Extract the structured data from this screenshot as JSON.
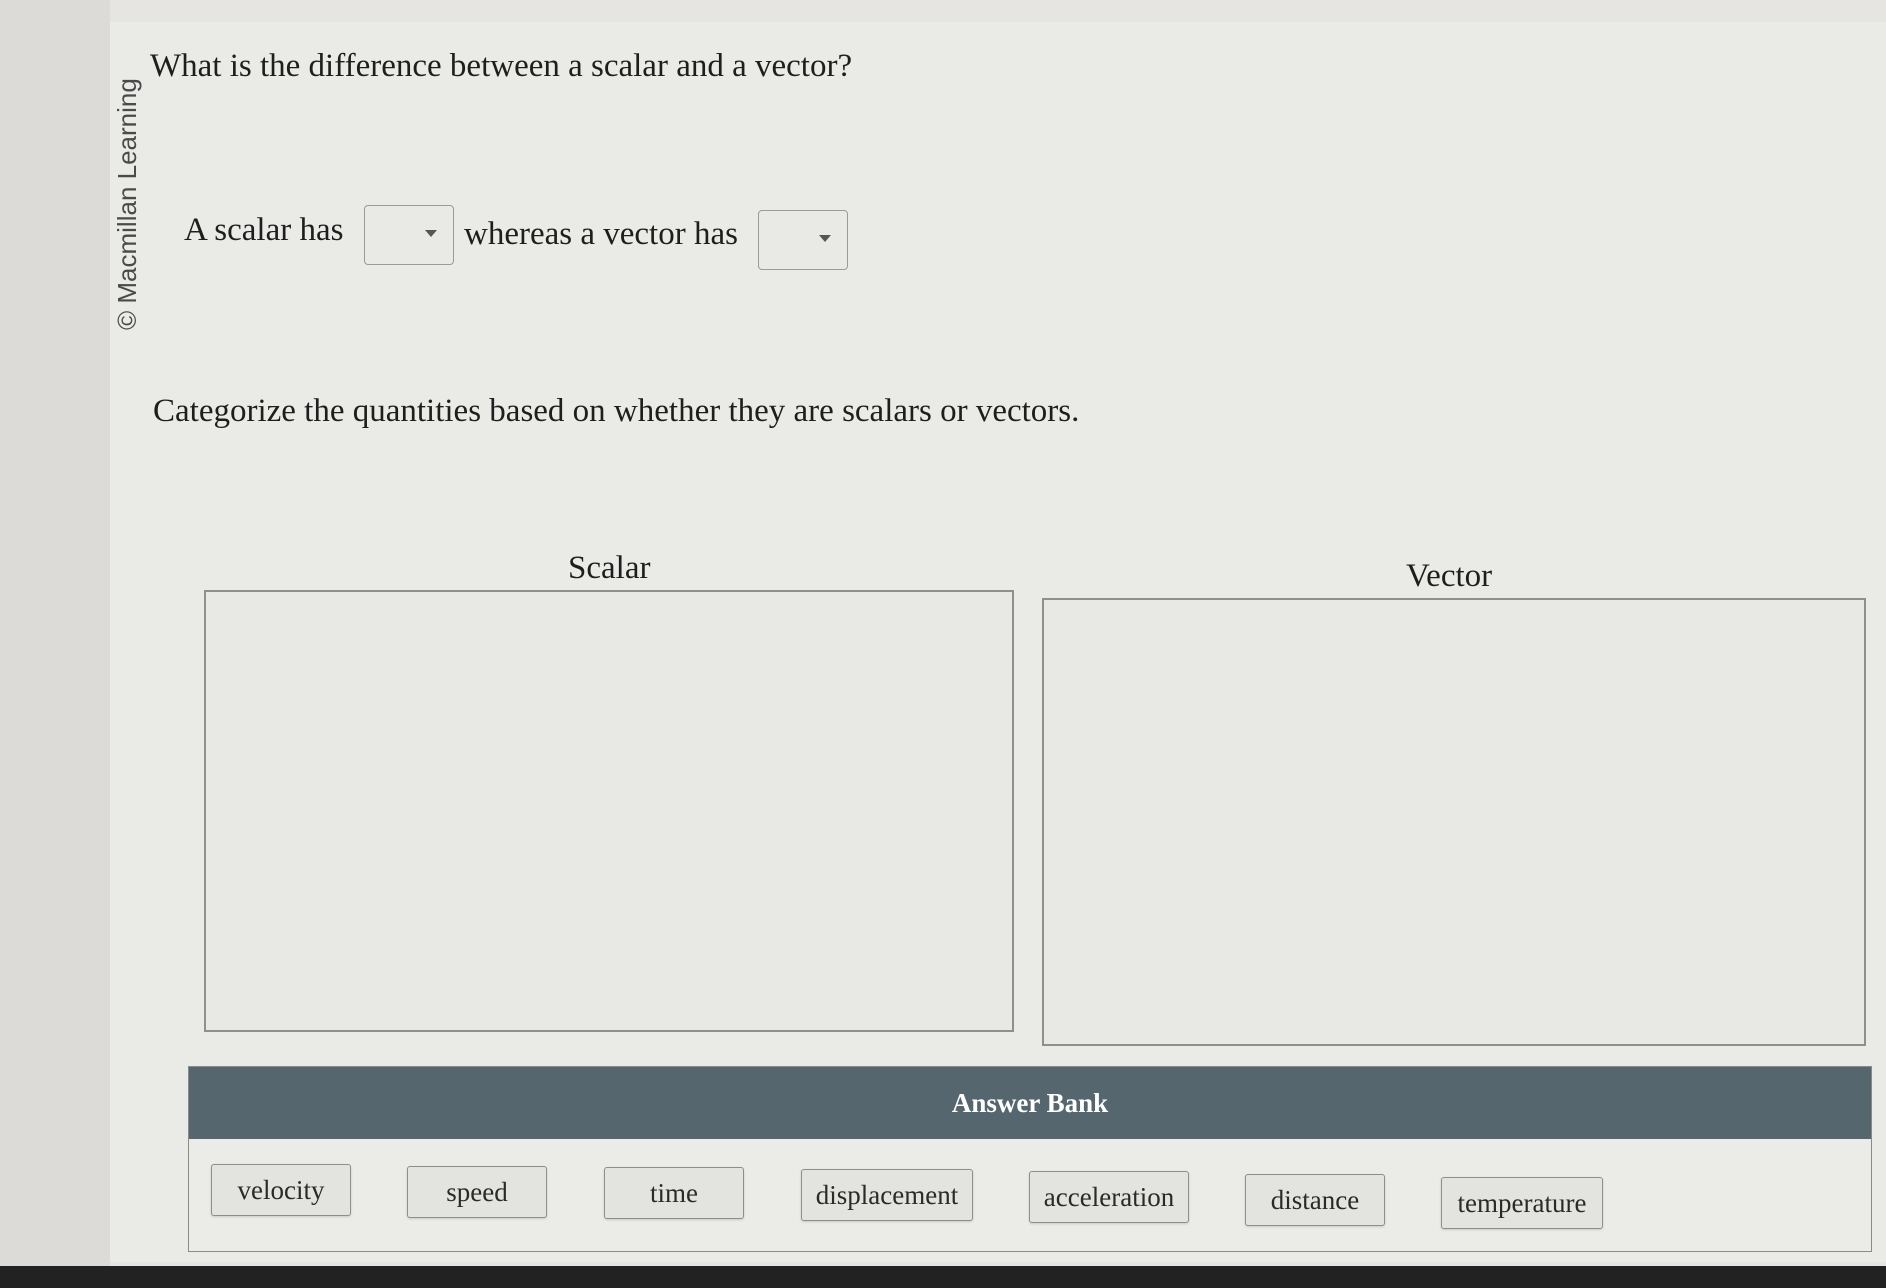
{
  "watermark": "© Macmillan Learning",
  "question": "What is the difference between a scalar and a vector?",
  "sentence": {
    "part1": "A scalar has",
    "part2": "whereas a vector has",
    "dropdown1_value": "",
    "dropdown2_value": ""
  },
  "instruction": "Categorize the quantities based on whether they are scalars or vectors.",
  "bins": {
    "scalar_title": "Scalar",
    "vector_title": "Vector"
  },
  "answer_bank": {
    "title": "Answer Bank",
    "items": [
      "velocity",
      "speed",
      "time",
      "displacement",
      "acceleration",
      "distance",
      "temperature"
    ]
  },
  "colors": {
    "bank_header": "#56666f",
    "page_background": "#eaeae7"
  }
}
